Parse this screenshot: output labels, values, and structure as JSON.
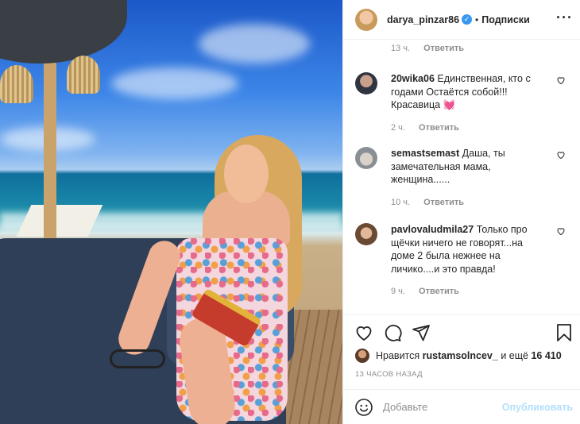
{
  "header": {
    "username": "darya_pinzar86",
    "verified_icon": "verified-badge-icon",
    "separator": "•",
    "follow_label": "Подписки",
    "more_icon": "more-options-icon"
  },
  "comments": {
    "top_meta": {
      "time": "13 ч.",
      "reply": "Ответить"
    },
    "items": [
      {
        "user": "20wika06",
        "text": "Единственная, кто с годами Остаётся собой!!! Красавица 💓",
        "time": "2 ч.",
        "reply": "Ответить"
      },
      {
        "user": "semastsemast",
        "text": "Даша, ты замечательная мама, женщина......",
        "time": "10 ч.",
        "reply": "Ответить"
      },
      {
        "user": "pavlovaludmila27",
        "text": "Только про щёчки ничего не говорят...на доме 2 была нежнее на личико....и это правда!",
        "time": "9 ч.",
        "reply": "Ответить"
      }
    ]
  },
  "actions": {
    "like_icon": "heart-icon",
    "comment_icon": "comment-icon",
    "share_icon": "send-icon",
    "save_icon": "bookmark-icon"
  },
  "likes": {
    "prefix": "Нравится",
    "user": "rustamsolncev_",
    "middle": "и ещё",
    "count": "16 410"
  },
  "timestamp": "13 ЧАСОВ НАЗАД",
  "add_comment": {
    "placeholder": "Добавьте",
    "publish_label": "Опубликовать",
    "emoji_icon": "smile-icon"
  },
  "colors": {
    "accent": "#3897f0",
    "publish_disabled": "#b2dffc",
    "meta_text": "#8e8e8e"
  }
}
